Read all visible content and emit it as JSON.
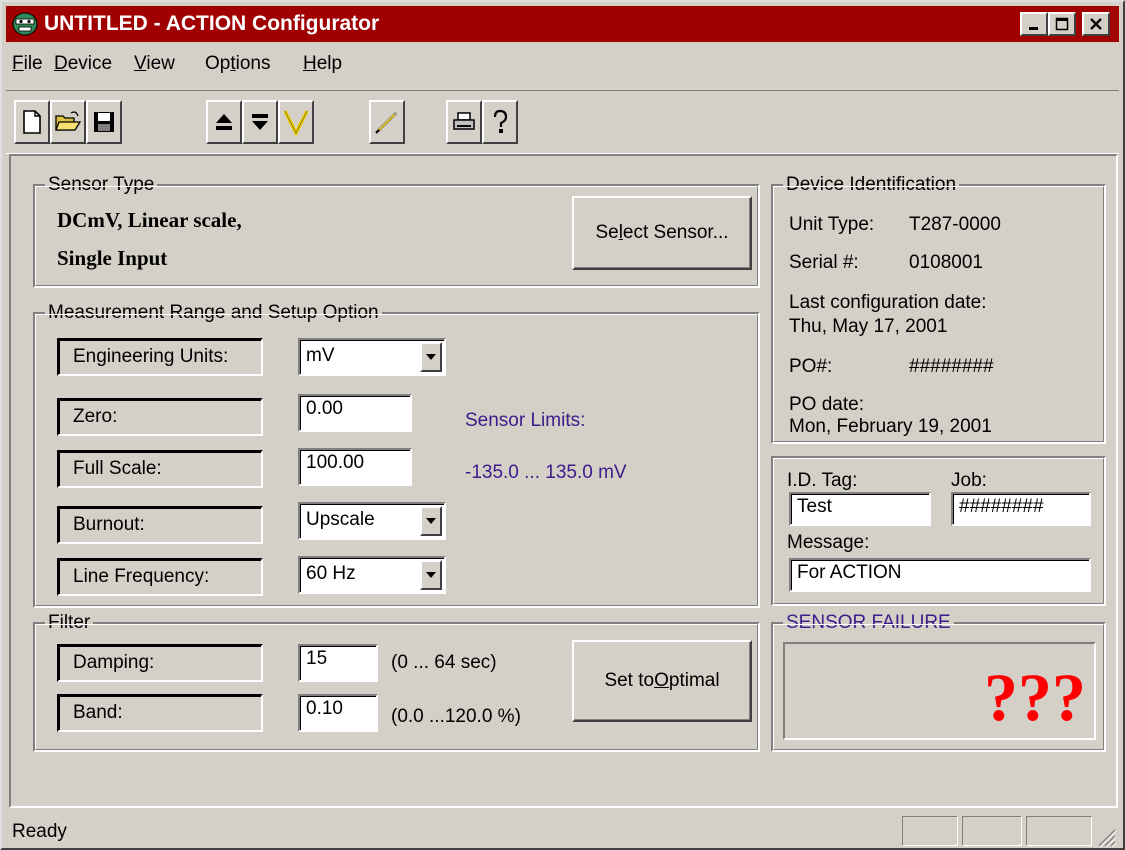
{
  "window": {
    "title": "UNTITLED - ACTION Configurator"
  },
  "menu": [
    {
      "pre": "",
      "u": "F",
      "post": "ile"
    },
    {
      "pre": "",
      "u": "D",
      "post": "evice"
    },
    {
      "pre": "",
      "u": "V",
      "post": "iew"
    },
    {
      "pre": "Op",
      "u": "t",
      "post": "ions"
    },
    {
      "pre": "",
      "u": "H",
      "post": "elp"
    }
  ],
  "sensor_type": {
    "legend": "Sensor Type",
    "line1": "DCmV, Linear scale,",
    "line2": "Single Input",
    "select_pre": "Se",
    "select_u": "l",
    "select_post": "ect Sensor..."
  },
  "measurement": {
    "legend": "Measurement Range and Setup Option",
    "eng_units_label": "Engineering Units:",
    "eng_units_value": "mV",
    "zero_label": "Zero:",
    "zero_value": "0.00",
    "full_scale_label": "Full Scale:",
    "full_scale_value": "100.00",
    "burnout_label": "Burnout:",
    "burnout_value": "Upscale",
    "line_freq_label": "Line Frequency:",
    "line_freq_value": "60 Hz",
    "sensor_limits_label": "Sensor Limits:",
    "sensor_limits_value": "-135.0 ... 135.0 mV"
  },
  "filter": {
    "legend": "Filter",
    "damping_label": "Damping:",
    "damping_value": "15",
    "damping_range": "(0 ... 64 sec)",
    "band_label": "Band:",
    "band_value": "0.10",
    "band_range": "(0.0 ...120.0 %)",
    "optimal_pre": "Set to ",
    "optimal_u": "O",
    "optimal_post": "ptimal"
  },
  "device_id": {
    "legend": "Device Identification",
    "unit_type_label": "Unit Type:",
    "unit_type_value": "T287-0000",
    "serial_label": "Serial #:",
    "serial_value": "0108001",
    "last_config_label": "Last configuration date:",
    "last_config_value": "Thu, May 17, 2001",
    "po_label": "PO#:",
    "po_value": "########",
    "po_date_label": "PO date:",
    "po_date_value": "Mon, February 19, 2001"
  },
  "tags": {
    "id_tag_label": "I.D. Tag:",
    "id_tag_value": "Test",
    "job_label": "Job:",
    "job_value": "########",
    "message_label": "Message:",
    "message_value": "For ACTION"
  },
  "sensor_failure": {
    "legend": "SENSOR FAILURE",
    "indicator": "???"
  },
  "status": {
    "text": "Ready"
  },
  "colors": {
    "titlebar": "#a00000",
    "accent_purple": "#3c1b8a",
    "failure_red": "#ff0000"
  }
}
